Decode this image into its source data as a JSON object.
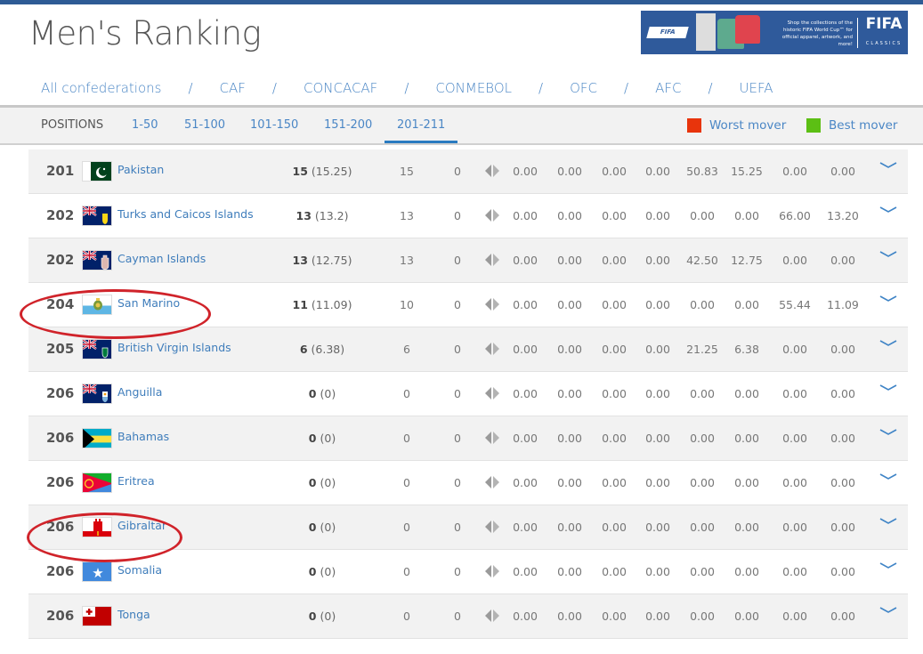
{
  "page": {
    "title": "Men's Ranking"
  },
  "banner": {
    "small_logo": "FIFA",
    "promo_text": "Shop the collections of the historic FIFA World Cup™ for official apparel, artwork, and more!",
    "brand": "FIFA",
    "brand_sub": "CLASSICS",
    "colors": {
      "background": "#2f5a9b"
    }
  },
  "confederations": {
    "items": [
      {
        "label": "All confederations"
      },
      {
        "label": "CAF"
      },
      {
        "label": "CONCACAF"
      },
      {
        "label": "CONMEBOL"
      },
      {
        "label": "OFC"
      },
      {
        "label": "AFC"
      },
      {
        "label": "UEFA"
      }
    ],
    "separator": "/"
  },
  "positions": {
    "label": "POSITIONS",
    "tabs": [
      {
        "label": "1-50"
      },
      {
        "label": "51-100"
      },
      {
        "label": "101-150"
      },
      {
        "label": "151-200"
      },
      {
        "label": "201-211",
        "active": true
      }
    ]
  },
  "legend": {
    "worst": {
      "label": "Worst mover",
      "color": "#e8340c"
    },
    "best": {
      "label": "Best mover",
      "color": "#5cbf14"
    }
  },
  "rows": [
    {
      "rank": "201",
      "country": "Pakistan",
      "flag": "pakistan-flag",
      "pts": "15",
      "pts_exact": "(15.25)",
      "prev": "15",
      "move": "0",
      "vals": [
        "0.00",
        "0.00",
        "0.00",
        "0.00",
        "50.83",
        "15.25",
        "0.00",
        "0.00"
      ],
      "circled": false
    },
    {
      "rank": "202",
      "country": "Turks and Caicos Islands",
      "flag": "turks-caicos-flag",
      "pts": "13",
      "pts_exact": "(13.2)",
      "prev": "13",
      "move": "0",
      "vals": [
        "0.00",
        "0.00",
        "0.00",
        "0.00",
        "0.00",
        "0.00",
        "66.00",
        "13.20"
      ],
      "circled": false
    },
    {
      "rank": "202",
      "country": "Cayman Islands",
      "flag": "cayman-islands-flag",
      "pts": "13",
      "pts_exact": "(12.75)",
      "prev": "13",
      "move": "0",
      "vals": [
        "0.00",
        "0.00",
        "0.00",
        "0.00",
        "42.50",
        "12.75",
        "0.00",
        "0.00"
      ],
      "circled": false
    },
    {
      "rank": "204",
      "country": "San Marino",
      "flag": "san-marino-flag",
      "pts": "11",
      "pts_exact": "(11.09)",
      "prev": "10",
      "move": "0",
      "vals": [
        "0.00",
        "0.00",
        "0.00",
        "0.00",
        "0.00",
        "0.00",
        "55.44",
        "11.09"
      ],
      "circled": true
    },
    {
      "rank": "205",
      "country": "British Virgin Islands",
      "flag": "british-virgin-islands-flag",
      "pts": "6",
      "pts_exact": "(6.38)",
      "prev": "6",
      "move": "0",
      "vals": [
        "0.00",
        "0.00",
        "0.00",
        "0.00",
        "21.25",
        "6.38",
        "0.00",
        "0.00"
      ],
      "circled": false
    },
    {
      "rank": "206",
      "country": "Anguilla",
      "flag": "anguilla-flag",
      "pts": "0",
      "pts_exact": "(0)",
      "prev": "0",
      "move": "0",
      "vals": [
        "0.00",
        "0.00",
        "0.00",
        "0.00",
        "0.00",
        "0.00",
        "0.00",
        "0.00"
      ],
      "circled": false
    },
    {
      "rank": "206",
      "country": "Bahamas",
      "flag": "bahamas-flag",
      "pts": "0",
      "pts_exact": "(0)",
      "prev": "0",
      "move": "0",
      "vals": [
        "0.00",
        "0.00",
        "0.00",
        "0.00",
        "0.00",
        "0.00",
        "0.00",
        "0.00"
      ],
      "circled": false
    },
    {
      "rank": "206",
      "country": "Eritrea",
      "flag": "eritrea-flag",
      "pts": "0",
      "pts_exact": "(0)",
      "prev": "0",
      "move": "0",
      "vals": [
        "0.00",
        "0.00",
        "0.00",
        "0.00",
        "0.00",
        "0.00",
        "0.00",
        "0.00"
      ],
      "circled": false
    },
    {
      "rank": "206",
      "country": "Gibraltar",
      "flag": "gibraltar-flag",
      "pts": "0",
      "pts_exact": "(0)",
      "prev": "0",
      "move": "0",
      "vals": [
        "0.00",
        "0.00",
        "0.00",
        "0.00",
        "0.00",
        "0.00",
        "0.00",
        "0.00"
      ],
      "circled": true
    },
    {
      "rank": "206",
      "country": "Somalia",
      "flag": "somalia-flag",
      "pts": "0",
      "pts_exact": "(0)",
      "prev": "0",
      "move": "0",
      "vals": [
        "0.00",
        "0.00",
        "0.00",
        "0.00",
        "0.00",
        "0.00",
        "0.00",
        "0.00"
      ],
      "circled": false
    },
    {
      "rank": "206",
      "country": "Tonga",
      "flag": "tonga-flag",
      "pts": "0",
      "pts_exact": "(0)",
      "prev": "0",
      "move": "0",
      "vals": [
        "0.00",
        "0.00",
        "0.00",
        "0.00",
        "0.00",
        "0.00",
        "0.00",
        "0.00"
      ],
      "circled": false
    }
  ],
  "annotation_color": "#d0232a"
}
